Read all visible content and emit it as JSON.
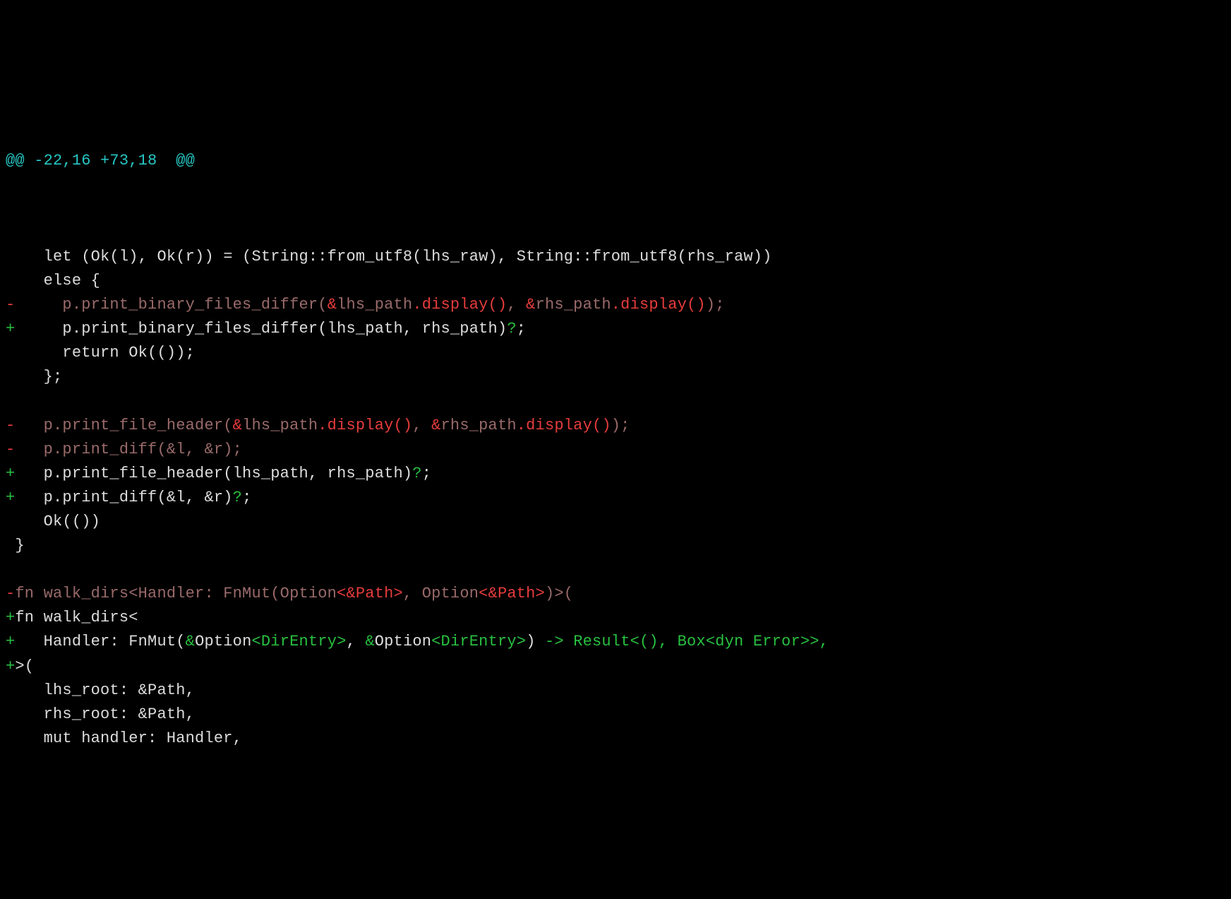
{
  "diff": {
    "hunk_header": "@@ -22,16 +73,18  @@",
    "lines": [
      {
        "prefix": " ",
        "type": "context",
        "segments": [
          {
            "cls": "ctx",
            "text": ""
          }
        ]
      },
      {
        "prefix": " ",
        "type": "context",
        "segments": [
          {
            "cls": "ctx",
            "text": "   let (Ok(l), Ok(r)) = (String::from_utf8(lhs_raw), String::from_utf8(rhs_raw))"
          }
        ]
      },
      {
        "prefix": " ",
        "type": "context",
        "segments": [
          {
            "cls": "ctx",
            "text": "   else {"
          }
        ]
      },
      {
        "prefix": "-",
        "type": "del",
        "segments": [
          {
            "cls": "del-dim",
            "text": "     p.print_binary_files_differ("
          },
          {
            "cls": "del-red",
            "text": "&"
          },
          {
            "cls": "del-dim",
            "text": "lhs_path"
          },
          {
            "cls": "del-red",
            "text": ".display()"
          },
          {
            "cls": "del-dim",
            "text": ", "
          },
          {
            "cls": "del-red",
            "text": "&"
          },
          {
            "cls": "del-dim",
            "text": "rhs_path"
          },
          {
            "cls": "del-red",
            "text": ".display()"
          },
          {
            "cls": "del-dim",
            "text": ");"
          }
        ]
      },
      {
        "prefix": "+",
        "type": "add",
        "segments": [
          {
            "cls": "add-ctx",
            "text": "     p.print_binary_files_differ(lhs_path, rhs_path)"
          },
          {
            "cls": "add-grn",
            "text": "?"
          },
          {
            "cls": "add-ctx",
            "text": ";"
          }
        ]
      },
      {
        "prefix": " ",
        "type": "context",
        "segments": [
          {
            "cls": "ctx",
            "text": "     return Ok(());"
          }
        ]
      },
      {
        "prefix": " ",
        "type": "context",
        "segments": [
          {
            "cls": "ctx",
            "text": "   };"
          }
        ]
      },
      {
        "prefix": " ",
        "type": "context",
        "segments": [
          {
            "cls": "ctx",
            "text": ""
          }
        ]
      },
      {
        "prefix": "-",
        "type": "del",
        "segments": [
          {
            "cls": "del-dim",
            "text": "   p.print_file_header("
          },
          {
            "cls": "del-red",
            "text": "&"
          },
          {
            "cls": "del-dim",
            "text": "lhs_path"
          },
          {
            "cls": "del-red",
            "text": ".display()"
          },
          {
            "cls": "del-dim",
            "text": ", "
          },
          {
            "cls": "del-red",
            "text": "&"
          },
          {
            "cls": "del-dim",
            "text": "rhs_path"
          },
          {
            "cls": "del-red",
            "text": ".display()"
          },
          {
            "cls": "del-dim",
            "text": ");"
          }
        ]
      },
      {
        "prefix": "-",
        "type": "del",
        "segments": [
          {
            "cls": "del-dim",
            "text": "   p.print_diff(&l, &r);"
          }
        ]
      },
      {
        "prefix": "+",
        "type": "add",
        "segments": [
          {
            "cls": "add-ctx",
            "text": "   p.print_file_header(lhs_path, rhs_path)"
          },
          {
            "cls": "add-grn",
            "text": "?"
          },
          {
            "cls": "add-ctx",
            "text": ";"
          }
        ]
      },
      {
        "prefix": "+",
        "type": "add",
        "segments": [
          {
            "cls": "add-ctx",
            "text": "   p.print_diff(&l, &r)"
          },
          {
            "cls": "add-grn",
            "text": "?"
          },
          {
            "cls": "add-ctx",
            "text": ";"
          }
        ]
      },
      {
        "prefix": " ",
        "type": "context",
        "segments": [
          {
            "cls": "ctx",
            "text": "   Ok(())"
          }
        ]
      },
      {
        "prefix": " ",
        "type": "context",
        "segments": [
          {
            "cls": "ctx",
            "text": "}"
          }
        ]
      },
      {
        "prefix": " ",
        "type": "context",
        "segments": [
          {
            "cls": "ctx",
            "text": ""
          }
        ]
      },
      {
        "prefix": "-",
        "type": "del",
        "segments": [
          {
            "cls": "del-dim",
            "text": "fn walk_dirs<Handler: FnMut(Option"
          },
          {
            "cls": "del-red",
            "text": "<&Path>"
          },
          {
            "cls": "del-dim",
            "text": ", Option"
          },
          {
            "cls": "del-red",
            "text": "<&Path>"
          },
          {
            "cls": "del-dim",
            "text": ")>("
          }
        ]
      },
      {
        "prefix": "+",
        "type": "add",
        "segments": [
          {
            "cls": "add-ctx",
            "text": "fn walk_dirs<"
          }
        ]
      },
      {
        "prefix": "+",
        "type": "add",
        "segments": [
          {
            "cls": "add-ctx",
            "text": "   Handler: FnMut("
          },
          {
            "cls": "add-grn",
            "text": "&"
          },
          {
            "cls": "add-ctx",
            "text": "Option"
          },
          {
            "cls": "add-grn",
            "text": "<DirEntry>"
          },
          {
            "cls": "add-ctx",
            "text": ", "
          },
          {
            "cls": "add-grn",
            "text": "&"
          },
          {
            "cls": "add-ctx",
            "text": "Option"
          },
          {
            "cls": "add-grn",
            "text": "<DirEntry>"
          },
          {
            "cls": "add-ctx",
            "text": ")"
          },
          {
            "cls": "add-grn",
            "text": " -> Result<(), Box<dyn Error>>,"
          }
        ]
      },
      {
        "prefix": "+",
        "type": "add",
        "segments": [
          {
            "cls": "add-ctx",
            "text": ">("
          }
        ]
      },
      {
        "prefix": " ",
        "type": "context",
        "segments": [
          {
            "cls": "ctx",
            "text": "   lhs_root: &Path,"
          }
        ]
      },
      {
        "prefix": " ",
        "type": "context",
        "segments": [
          {
            "cls": "ctx",
            "text": "   rhs_root: &Path,"
          }
        ]
      },
      {
        "prefix": " ",
        "type": "context",
        "segments": [
          {
            "cls": "ctx",
            "text": "   mut handler: Handler,"
          }
        ]
      }
    ]
  }
}
